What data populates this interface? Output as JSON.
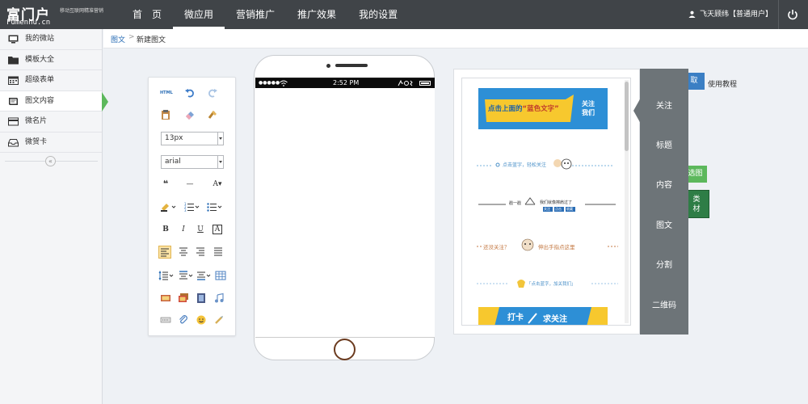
{
  "brand": {
    "logo_text": "富门户",
    "tagline": "移动互联网精准营销",
    "domain": "Fumenhu.cn"
  },
  "nav": {
    "items": [
      {
        "label": "首　页"
      },
      {
        "label": "微应用"
      },
      {
        "label": "营销推广"
      },
      {
        "label": "推广效果"
      },
      {
        "label": "我的设置"
      }
    ],
    "active_index": 1
  },
  "user": {
    "label": "飞天顾纬【普通用户】"
  },
  "sidebar": {
    "items": [
      {
        "label": "我的微站",
        "icon": "monitor-icon"
      },
      {
        "label": "模板大全",
        "icon": "folder-icon"
      },
      {
        "label": "超级表单",
        "icon": "calendar-icon"
      },
      {
        "label": "图文内容",
        "icon": "book-icon"
      },
      {
        "label": "微名片",
        "icon": "card-icon"
      },
      {
        "label": "微贺卡",
        "icon": "inbox-icon"
      }
    ],
    "active_index": 3,
    "collapse_glyph": "«"
  },
  "breadcrumb": {
    "parent": "图文",
    "separator": ">",
    "current": "新建图文"
  },
  "editor": {
    "font_size": "13px",
    "font_family": "arial",
    "quote_glyph": "❝",
    "hr_glyph": "—",
    "font_color_glyph": "A",
    "bold": "B",
    "italic": "I",
    "underline": "U",
    "border_char": "A"
  },
  "phone": {
    "time": "2:52 PM",
    "signal": "●●●●●"
  },
  "materials": {
    "banner1_text": "点击上面的“蓝色文字”关注我们",
    "banner1_left": "点击上面的",
    "banner1_mid": "“蓝色文字”",
    "banner1_right": "关注\n我们",
    "line1": "点击蓝字，轻松关注",
    "line2_top": "戳一戳",
    "line2_mid": "我们就像擦肩过了",
    "line2_btns": [
      "关注",
      "点击",
      "收藏"
    ],
    "line3_left": "还没关注？",
    "line3_right": "伸出手指点这里",
    "line4": "「点击蓝字，加关我们」",
    "banner2_left": "打卡",
    "banner2_right": "求关注"
  },
  "tabs": {
    "items": [
      "关注",
      "标题",
      "内容",
      "图文",
      "分割",
      "二维码"
    ],
    "active_index": 0
  },
  "right_panel": {
    "fetch_label": "取",
    "help_label": "使用教程",
    "green1_label": "选图",
    "green2_label": "类\n材"
  },
  "colors": {
    "topbar": "#404448",
    "accent_green": "#5cb85c",
    "tab_bg": "#6d7478",
    "link_blue": "#2a6db5",
    "banner_blue": "#2d8fd6",
    "banner_yellow": "#f7c82e"
  }
}
